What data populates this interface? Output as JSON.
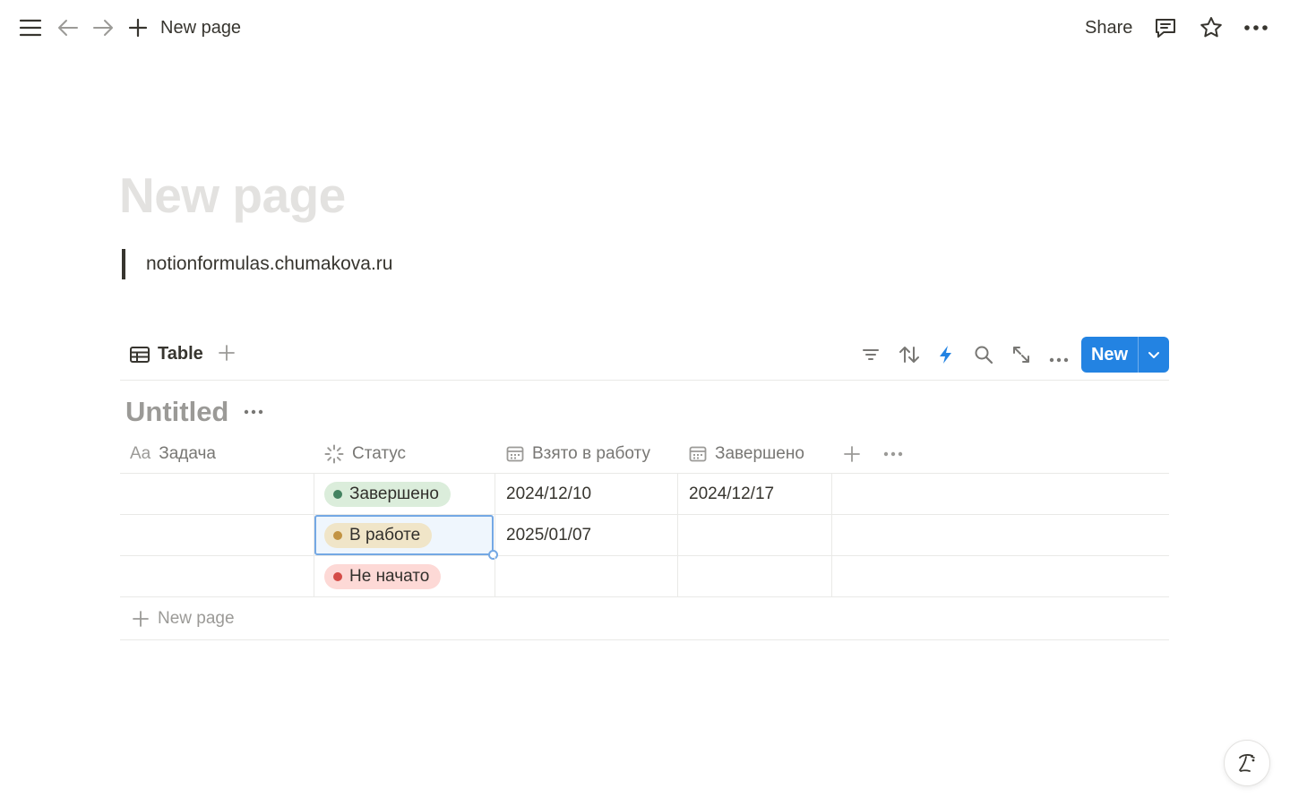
{
  "topbar": {
    "page_title": "New page",
    "share_label": "Share"
  },
  "page": {
    "title": "New page",
    "quote": "notionformulas.chumakova.ru"
  },
  "view": {
    "tab_label": "Table",
    "new_label": "New"
  },
  "database": {
    "title": "Untitled",
    "columns": [
      {
        "label": "Задача",
        "prefix": "Aa",
        "icon": "title-icon"
      },
      {
        "label": "Статус",
        "icon": "status-icon"
      },
      {
        "label": "Взято в работу",
        "icon": "calendar-icon"
      },
      {
        "label": "Завершено",
        "icon": "calendar-icon"
      }
    ],
    "rows": [
      {
        "task": "",
        "status": "Завершено",
        "status_color": "#448361",
        "status_bg": "#dbeddb",
        "started": "2024/12/10",
        "finished": "2024/12/17"
      },
      {
        "task": "",
        "status": "В работе",
        "status_color": "#c29343",
        "status_bg": "#f0e5c8",
        "started": "2025/01/07",
        "finished": ""
      },
      {
        "task": "",
        "status": "Не начато",
        "status_color": "#d44c47",
        "status_bg": "#fdd9d6",
        "started": "",
        "finished": ""
      }
    ],
    "new_row_label": "New page"
  },
  "colors": {
    "accent": "#2383e2",
    "text": "#37352f",
    "muted": "#787774",
    "title_placeholder": "#e3e2e0"
  }
}
